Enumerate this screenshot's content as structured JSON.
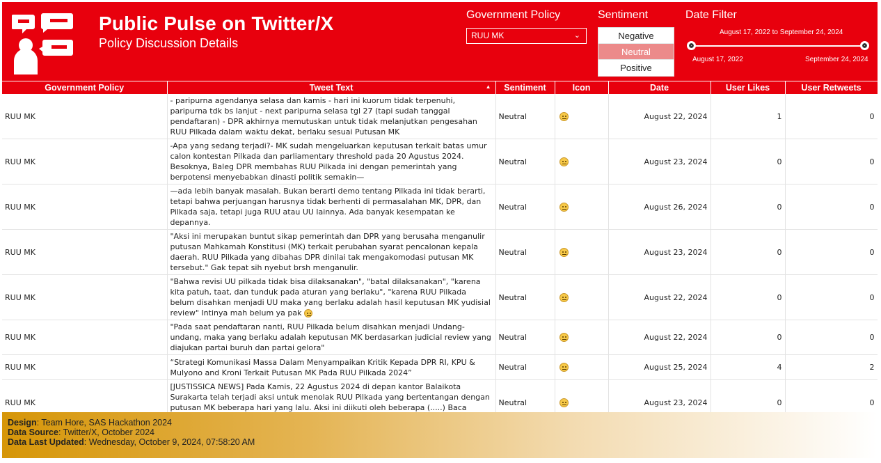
{
  "header": {
    "title": "Public Pulse on Twitter/X",
    "subtitle": "Policy Discussion Details",
    "brand_color": "#e8000d",
    "icon": "people-chat-icon"
  },
  "filters": {
    "policy_label": "Government Policy",
    "policy_value": "RUU MK",
    "sentiment_label": "Sentiment",
    "sentiment_options": [
      "Negative",
      "Neutral",
      "Positive"
    ],
    "sentiment_selected": "Neutral",
    "date_label": "Date Filter",
    "date_range_text": "August 17, 2022 to September 24, 2024",
    "date_min": "August 17, 2022",
    "date_max": "September 24, 2024"
  },
  "table": {
    "columns": [
      "Government Policy",
      "Tweet Text",
      "Sentiment",
      "Icon",
      "Date",
      "User Likes",
      "User Retweets"
    ],
    "rows": [
      {
        "policy": "RUU MK",
        "tweet": "- paripurna agendanya selasa dan kamis - hari ini kuorum tidak terpenuhi, paripurna tdk bs lanjut - next paripurna selasa tgl 27 (tapi sudah tanggal pendaftaran) - DPR akhirnya memutuskan untuk tidak melanjutkan pengesahan RUU Pilkada dalam waktu dekat, berlaku sesuai Putusan MK",
        "sentiment": "Neutral",
        "icon": "neutral-face-icon",
        "date": "August 22, 2024",
        "likes": "1",
        "retweets": "0"
      },
      {
        "policy": "RUU MK",
        "tweet": "-Apa yang sedang terjadi?- MK sudah mengeluarkan keputusan terkait batas umur calon kontestan Pilkada dan parliamentary threshold pada 20 Agustus 2024. Besoknya, Baleg DPR membahas RUU Pilkada ini dengan pemerintah yang berpotensi menyebabkan dinasti politik semakin—",
        "sentiment": "Neutral",
        "icon": "neutral-face-icon",
        "date": "August 23, 2024",
        "likes": "0",
        "retweets": "0"
      },
      {
        "policy": "RUU MK",
        "tweet": "—ada lebih banyak masalah. Bukan berarti demo tentang Pilkada ini tidak berarti, tetapi bahwa perjuangan harusnya tidak berhenti di permasalahan MK, DPR, dan Pilkada saja, tetapi juga RUU atau UU lainnya. Ada banyak kesempatan ke depannya.",
        "sentiment": "Neutral",
        "icon": "neutral-face-icon",
        "date": "August 26, 2024",
        "likes": "0",
        "retweets": "0"
      },
      {
        "policy": "RUU MK",
        "tweet": "\"Aksi ini merupakan buntut sikap pemerintah dan DPR yang berusaha menganulir putusan Mahkamah Konstitusi (MK) terkait perubahan syarat pencalonan kepala daerah. RUU Pilkada yang dibahas DPR dinilai tak mengakomodasi putusan MK tersebut.\" Gak tepat sih nyebut brsh menganulir.",
        "sentiment": "Neutral",
        "icon": "neutral-face-icon",
        "date": "August 23, 2024",
        "likes": "0",
        "retweets": "0"
      },
      {
        "policy": "RUU MK",
        "tweet": "\"Bahwa revisi UU pilkada tidak bisa dilaksanakan\", \"batal dilaksanakan\", \"karena kita patuh, taat, dan tunduk pada aturan yang berlaku\", \"karena RUU Pilkada belum disahkan menjadi UU maka yang berlaku adalah hasil keputusan MK yudisial review\" Intinya mah belum ya pak",
        "tweet_emoji": true,
        "sentiment": "Neutral",
        "icon": "neutral-face-icon",
        "date": "August 22, 2024",
        "likes": "0",
        "retweets": "0"
      },
      {
        "policy": "RUU MK",
        "tweet": "\"Pada saat pendaftaran nanti, RUU Pilkada belum disahkan menjadi Undang-undang, maka yang berlaku adalah keputusan MK berdasarkan judicial review yang diajukan partai buruh dan partai gelora\"",
        "sentiment": "Neutral",
        "icon": "neutral-face-icon",
        "date": "August 22, 2024",
        "likes": "0",
        "retweets": "0"
      },
      {
        "policy": "RUU MK",
        "tweet": "“Strategi Komunikasi Massa Dalam Menyampaikan Kritik Kepada DPR RI, KPU & Mulyono and Kroni Terkait Putusan MK Pada RUU Pilkada 2024”",
        "sentiment": "Neutral",
        "icon": "neutral-face-icon",
        "date": "August 25, 2024",
        "likes": "4",
        "retweets": "2"
      },
      {
        "policy": "RUU MK",
        "tweet": "[JUSTISSICA NEWS] Pada Kamis, 22 Agustus 2024 di depan kantor Balaikota Surakarta telah terjadi aksi untuk menolak RUU Pilkada yang bertentangan dengan putusan MK beberapa hari yang lalu. Aksi ini diikuti oleh beberapa (.....) Baca selengkapnya di lpmjustissica.wordpress.com",
        "sentiment": "Neutral",
        "icon": "neutral-face-icon",
        "date": "August 23, 2024",
        "likes": "0",
        "retweets": "0"
      }
    ]
  },
  "footer": {
    "design_label": "Design",
    "design_value": ": Team Hore, SAS Hackathon 2024",
    "source_label": "Data Source",
    "source_value": ": Twitter/X, October 2024",
    "updated_label": "Data Last Updated",
    "updated_value": ": Wednesday, October 9, 2024, 07:58:20 AM"
  }
}
